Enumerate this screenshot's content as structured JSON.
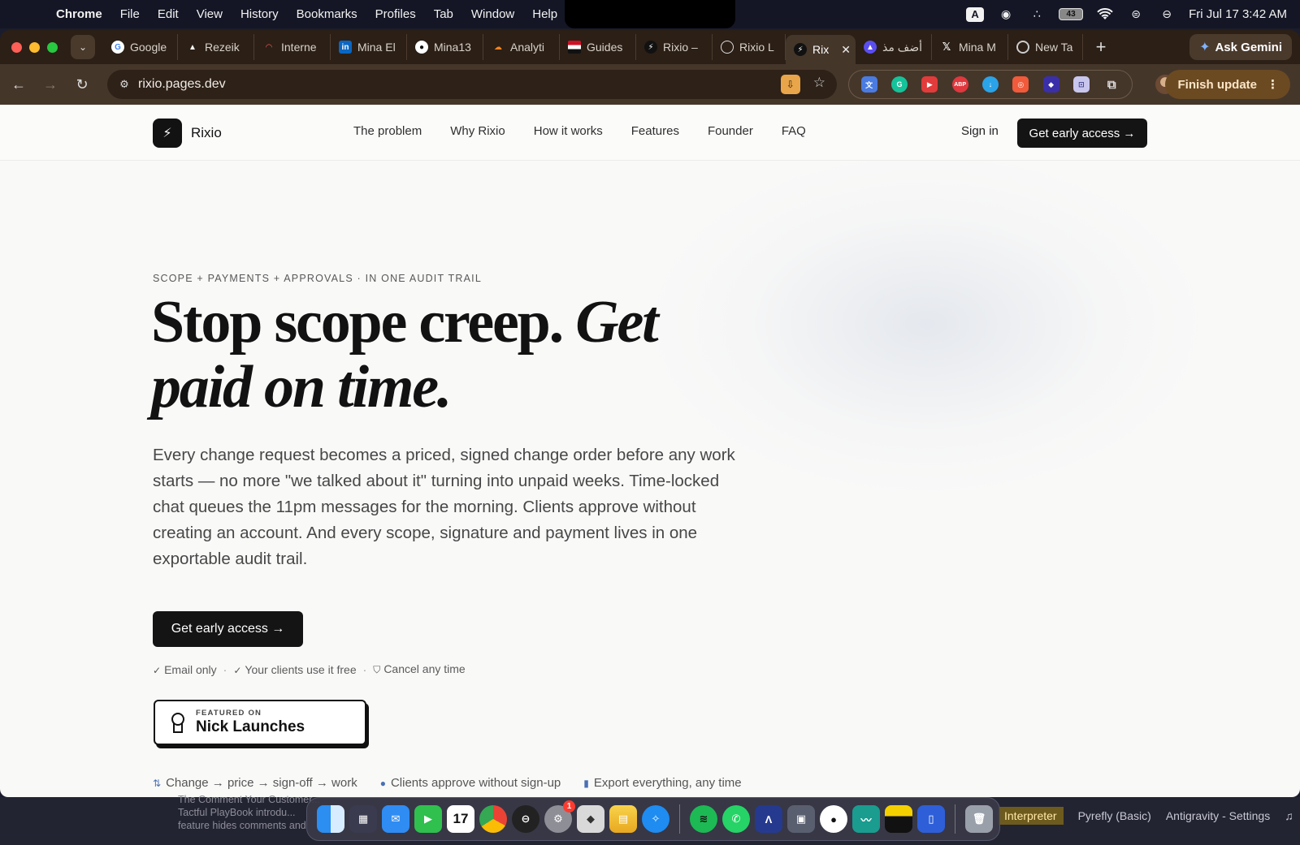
{
  "menubar": {
    "apple_glyph": "",
    "app": "Chrome",
    "items": [
      "File",
      "Edit",
      "View",
      "History",
      "Bookmarks",
      "Profiles",
      "Tab",
      "Window",
      "Help"
    ],
    "input_badge": "A",
    "battery": "43",
    "clock": "Fri Jul 17  3:42 AM"
  },
  "tabs": [
    {
      "label": "Google",
      "icon": "google-icon"
    },
    {
      "label": "Rezeik",
      "icon": "triangle-icon"
    },
    {
      "label": "Interne",
      "icon": "gauge-icon"
    },
    {
      "label": "Mina El",
      "icon": "linkedin-icon"
    },
    {
      "label": "Mina13",
      "icon": "github-icon"
    },
    {
      "label": "Analyti",
      "icon": "cloudflare-icon"
    },
    {
      "label": "Guides",
      "icon": "flag-icon"
    },
    {
      "label": "Rixio –",
      "icon": "bolt-icon"
    },
    {
      "label": "Rixio L",
      "icon": "circle-icon"
    },
    {
      "label": "Rix",
      "icon": "bolt-icon",
      "active": true
    },
    {
      "label": "أضف مذ",
      "icon": "arc-icon"
    },
    {
      "label": "Mina M",
      "icon": "x-icon"
    },
    {
      "label": "New Ta",
      "icon": "chrome-icon"
    }
  ],
  "gemini": {
    "label": "Ask Gemini"
  },
  "address": {
    "url": "rixio.pages.dev"
  },
  "finish_update": {
    "label": "Finish update"
  },
  "site": {
    "brand": "Rixio",
    "nav": [
      "The problem",
      "Why Rixio",
      "How it works",
      "Features",
      "Founder",
      "FAQ"
    ],
    "signin": "Sign in",
    "cta_top": "Get early access →",
    "eyebrow": "SCOPE + PAYMENTS + APPROVALS · IN ONE AUDIT TRAIL",
    "headline_plain": "Stop scope creep. ",
    "headline_italic": "Get paid on time.",
    "lede": "Every change request becomes a priced, signed change order before any work starts — no more \"we talked about it\" turning into unpaid weeks. Time-locked chat queues the 11pm messages for the morning. Clients approve without creating an account. And every scope, signature and payment lives in one exportable audit trail.",
    "cta_main": "Get early access →",
    "assurances": [
      "Email only",
      "Your clients use it free",
      "Cancel any time"
    ],
    "featured_small": "FEATURED ON",
    "featured_big": "Nick Launches",
    "benefits": [
      "Change → price → sign-off → work",
      "Clients approve without sign-up",
      "Export everything, any time"
    ]
  },
  "background": {
    "line1": "The Comment Your Customer...",
    "line2": "Tactful PlayBook introdu...",
    "line3": "feature hides comments and",
    "status": [
      "Interpreter",
      "Pyrefly (Basic)",
      "Antigravity - Settings"
    ]
  },
  "dock": {
    "calendar_day": "17",
    "settings_badge": "1",
    "items": [
      "finder-icon",
      "launchpad-icon",
      "mail-icon",
      "facetime-icon",
      "calendar-icon",
      "chrome-icon",
      "vpn-icon",
      "settings-icon",
      "box-icon",
      "notes-icon",
      "safari-icon",
      "spotify-icon",
      "whatsapp-icon",
      "arc-icon",
      "app-icon",
      "github-icon",
      "freeform-icon",
      "stickies-icon",
      "files-icon",
      "trash-icon"
    ]
  }
}
